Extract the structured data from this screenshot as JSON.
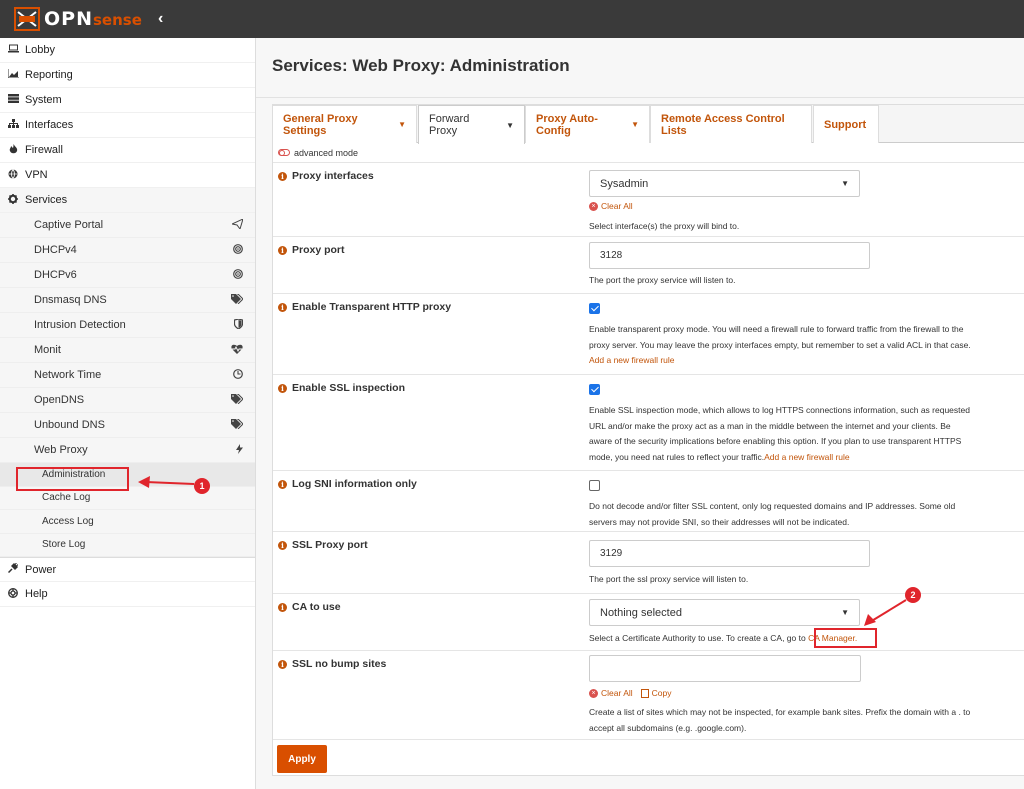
{
  "brand": {
    "name_main": "OPN",
    "name_sub": "sense",
    "accent": "#d94f00"
  },
  "topbar": {
    "toggle_glyph": "‹"
  },
  "sidebar": {
    "items_top": [
      {
        "label": "Lobby",
        "icon": "laptop-icon"
      },
      {
        "label": "Reporting",
        "icon": "chart-icon"
      },
      {
        "label": "System",
        "icon": "server-icon"
      },
      {
        "label": "Interfaces",
        "icon": "sitemap-icon"
      },
      {
        "label": "Firewall",
        "icon": "fire-icon"
      },
      {
        "label": "VPN",
        "icon": "globe-icon"
      },
      {
        "label": "Services",
        "icon": "gear-icon"
      }
    ],
    "services_sub": [
      {
        "label": "Captive Portal",
        "icon": "paper-plane-icon"
      },
      {
        "label": "DHCPv4",
        "icon": "bullseye-icon"
      },
      {
        "label": "DHCPv6",
        "icon": "bullseye-icon"
      },
      {
        "label": "Dnsmasq DNS",
        "icon": "tags-icon"
      },
      {
        "label": "Intrusion Detection",
        "icon": "shield-icon"
      },
      {
        "label": "Monit",
        "icon": "heartbeat-icon"
      },
      {
        "label": "Network Time",
        "icon": "clock-icon"
      },
      {
        "label": "OpenDNS",
        "icon": "tags-icon"
      },
      {
        "label": "Unbound DNS",
        "icon": "tags-icon"
      },
      {
        "label": "Web Proxy",
        "icon": "bolt-icon"
      }
    ],
    "webproxy_sub": [
      {
        "label": "Administration",
        "active": true
      },
      {
        "label": "Cache Log"
      },
      {
        "label": "Access Log"
      },
      {
        "label": "Store Log"
      }
    ],
    "items_bottom": [
      {
        "label": "Power",
        "icon": "plug-icon"
      },
      {
        "label": "Help",
        "icon": "lifebuoy-icon"
      }
    ]
  },
  "page": {
    "title": "Services: Web Proxy: Administration"
  },
  "tabs": [
    {
      "label": "General Proxy Settings",
      "dropdown": true
    },
    {
      "label": "Forward Proxy",
      "dropdown": true,
      "active": true
    },
    {
      "label": "Proxy Auto-Config",
      "dropdown": true
    },
    {
      "label": "Remote Access Control Lists",
      "dropdown": false
    },
    {
      "label": "Support",
      "dropdown": false
    }
  ],
  "advanced_mode": "advanced mode",
  "form": {
    "proxy_interfaces": {
      "label": "Proxy interfaces",
      "value": "Sysadmin",
      "clear": "Clear All",
      "help": "Select interface(s) the proxy will bind to."
    },
    "proxy_port": {
      "label": "Proxy port",
      "value": "3128",
      "help": "The port the proxy service will listen to."
    },
    "transparent": {
      "label": "Enable Transparent HTTP proxy",
      "checked": true,
      "help_1": "Enable transparent proxy mode. You will need a firewall rule to forward traffic from the firewall to the",
      "help_2": "proxy server. You may leave the proxy interfaces empty, but remember to set a valid ACL in that case.",
      "link": "Add a new firewall rule"
    },
    "ssl_inspection": {
      "label": "Enable SSL inspection",
      "checked": true,
      "help_1": "Enable SSL inspection mode, which allows to log HTTPS connections information, such as requested",
      "help_2": "URL and/or make the proxy act as a man in the middle between the internet and your clients. Be",
      "help_3": "aware of the security implications before enabling this option. If you plan to use transparent HTTPS",
      "help_4": "mode, you need nat rules to reflect your traffic.",
      "link": "Add a new firewall rule"
    },
    "log_sni": {
      "label": "Log SNI information only",
      "checked": false,
      "help_1": "Do not decode and/or filter SSL content, only log requested domains and IP addresses. Some old",
      "help_2": "servers may not provide SNI, so their addresses will not be indicated."
    },
    "ssl_port": {
      "label": "SSL Proxy port",
      "value": "3129",
      "help": "The port the ssl proxy service will listen to."
    },
    "ca": {
      "label": "CA to use",
      "value": "Nothing selected",
      "help": "Select a Certificate Authority to use. To create a CA, go to",
      "link": "CA Manager."
    },
    "no_bump": {
      "label": "SSL no bump sites",
      "value": "",
      "clear": "Clear All",
      "copy": "Copy",
      "help_1": "Create a list of sites which may not be inspected, for example bank sites. Prefix the domain with a . to",
      "help_2": "accept all subdomains (e.g. .google.com)."
    }
  },
  "apply_label": "Apply",
  "annotations": {
    "one": "1",
    "two": "2",
    "color": "#e0252c"
  }
}
